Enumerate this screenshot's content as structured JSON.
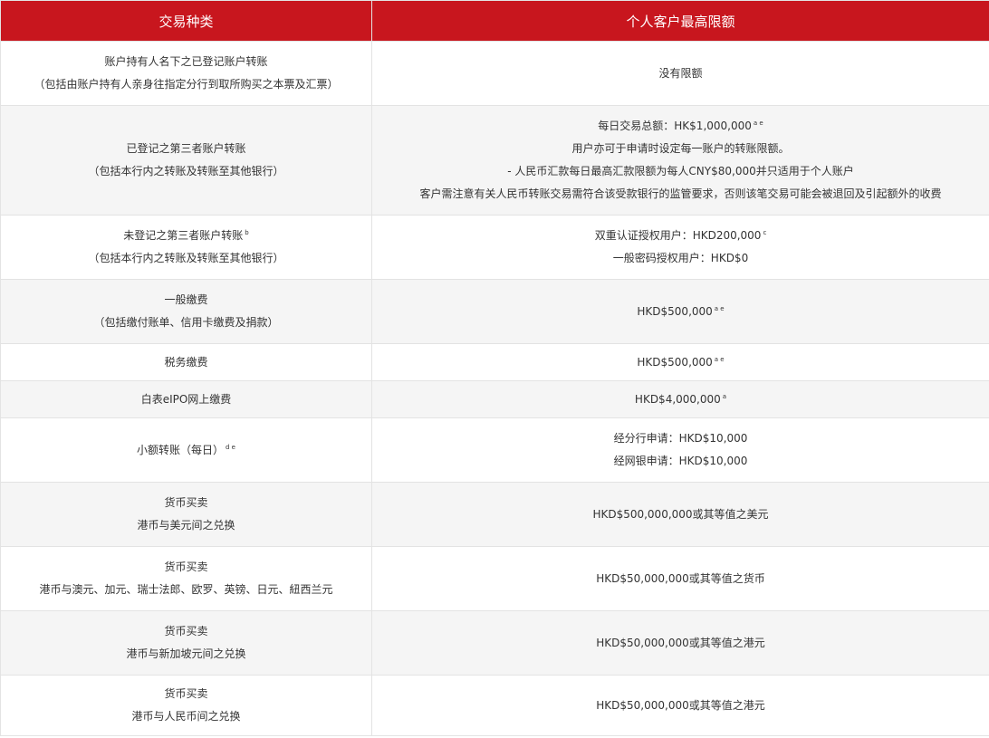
{
  "header": {
    "col1": "交易种类",
    "col2": "个人客户最高限额"
  },
  "rows": [
    {
      "type": [
        {
          "text": "账户持有人名下之已登记账户转账"
        },
        {
          "text": "（包括由账户持有人亲身往指定分行到取所购买之本票及汇票）"
        }
      ],
      "limit": [
        {
          "text": "没有限额"
        }
      ]
    },
    {
      "type": [
        {
          "text": "已登记之第三者账户转账"
        },
        {
          "text": "（包括本行内之转账及转账至其他银行）"
        }
      ],
      "limit": [
        {
          "text": "每日交易总额：HK$1,000,000",
          "sup": "a e"
        },
        {
          "text": "用户亦可于申请时设定每一账户的转账限额。"
        },
        {
          "text": "- 人民币汇款每日最高汇款限额为每人CNY$80,000并只适用于个人账户"
        },
        {
          "text": "客户需注意有关人民币转账交易需符合该受款银行的监管要求，否则该笔交易可能会被退回及引起额外的收费"
        }
      ]
    },
    {
      "type": [
        {
          "text": "未登记之第三者账户转账",
          "sup": "b"
        },
        {
          "text": "（包括本行内之转账及转账至其他银行）"
        }
      ],
      "limit": [
        {
          "text": "双重认证授权用户：HKD200,000",
          "sup": "c"
        },
        {
          "text": "一般密码授权用户：HKD$0"
        }
      ]
    },
    {
      "type": [
        {
          "text": "一般缴费"
        },
        {
          "text": "（包括缴付账单、信用卡缴费及捐款）"
        }
      ],
      "limit": [
        {
          "text": "HKD$500,000",
          "sup": "a e"
        }
      ]
    },
    {
      "type": [
        {
          "text": "税务缴费"
        }
      ],
      "limit": [
        {
          "text": "HKD$500,000",
          "sup": "a e"
        }
      ]
    },
    {
      "type": [
        {
          "text": "白表eIPO网上缴费"
        }
      ],
      "limit": [
        {
          "text": "HKD$4,000,000",
          "sup": "a"
        }
      ]
    },
    {
      "type": [
        {
          "text": "小额转账（每日）",
          "sup": "d e"
        }
      ],
      "limit": [
        {
          "text": "经分行申请：HKD$10,000"
        },
        {
          "text": "经网银申请：HKD$10,000"
        }
      ]
    },
    {
      "type": [
        {
          "text": "货币买卖"
        },
        {
          "text": "港币与美元间之兑换"
        }
      ],
      "limit": [
        {
          "text": "HKD$500,000,000或其等值之美元"
        }
      ]
    },
    {
      "type": [
        {
          "text": "货币买卖"
        },
        {
          "text": "港币与澳元、加元、瑞士法郎、欧罗、英镑、日元、紐西兰元"
        }
      ],
      "limit": [
        {
          "text": "HKD$50,000,000或其等值之货币"
        }
      ]
    },
    {
      "type": [
        {
          "text": "货币买卖"
        },
        {
          "text": "港币与新加坡元间之兑换"
        }
      ],
      "limit": [
        {
          "text": "HKD$50,000,000或其等值之港元"
        }
      ]
    },
    {
      "type": [
        {
          "text": "货币买卖"
        },
        {
          "text": "港币与人民币间之兑换"
        }
      ],
      "limit": [
        {
          "text": "HKD$50,000,000或其等值之港元"
        }
      ]
    }
  ]
}
